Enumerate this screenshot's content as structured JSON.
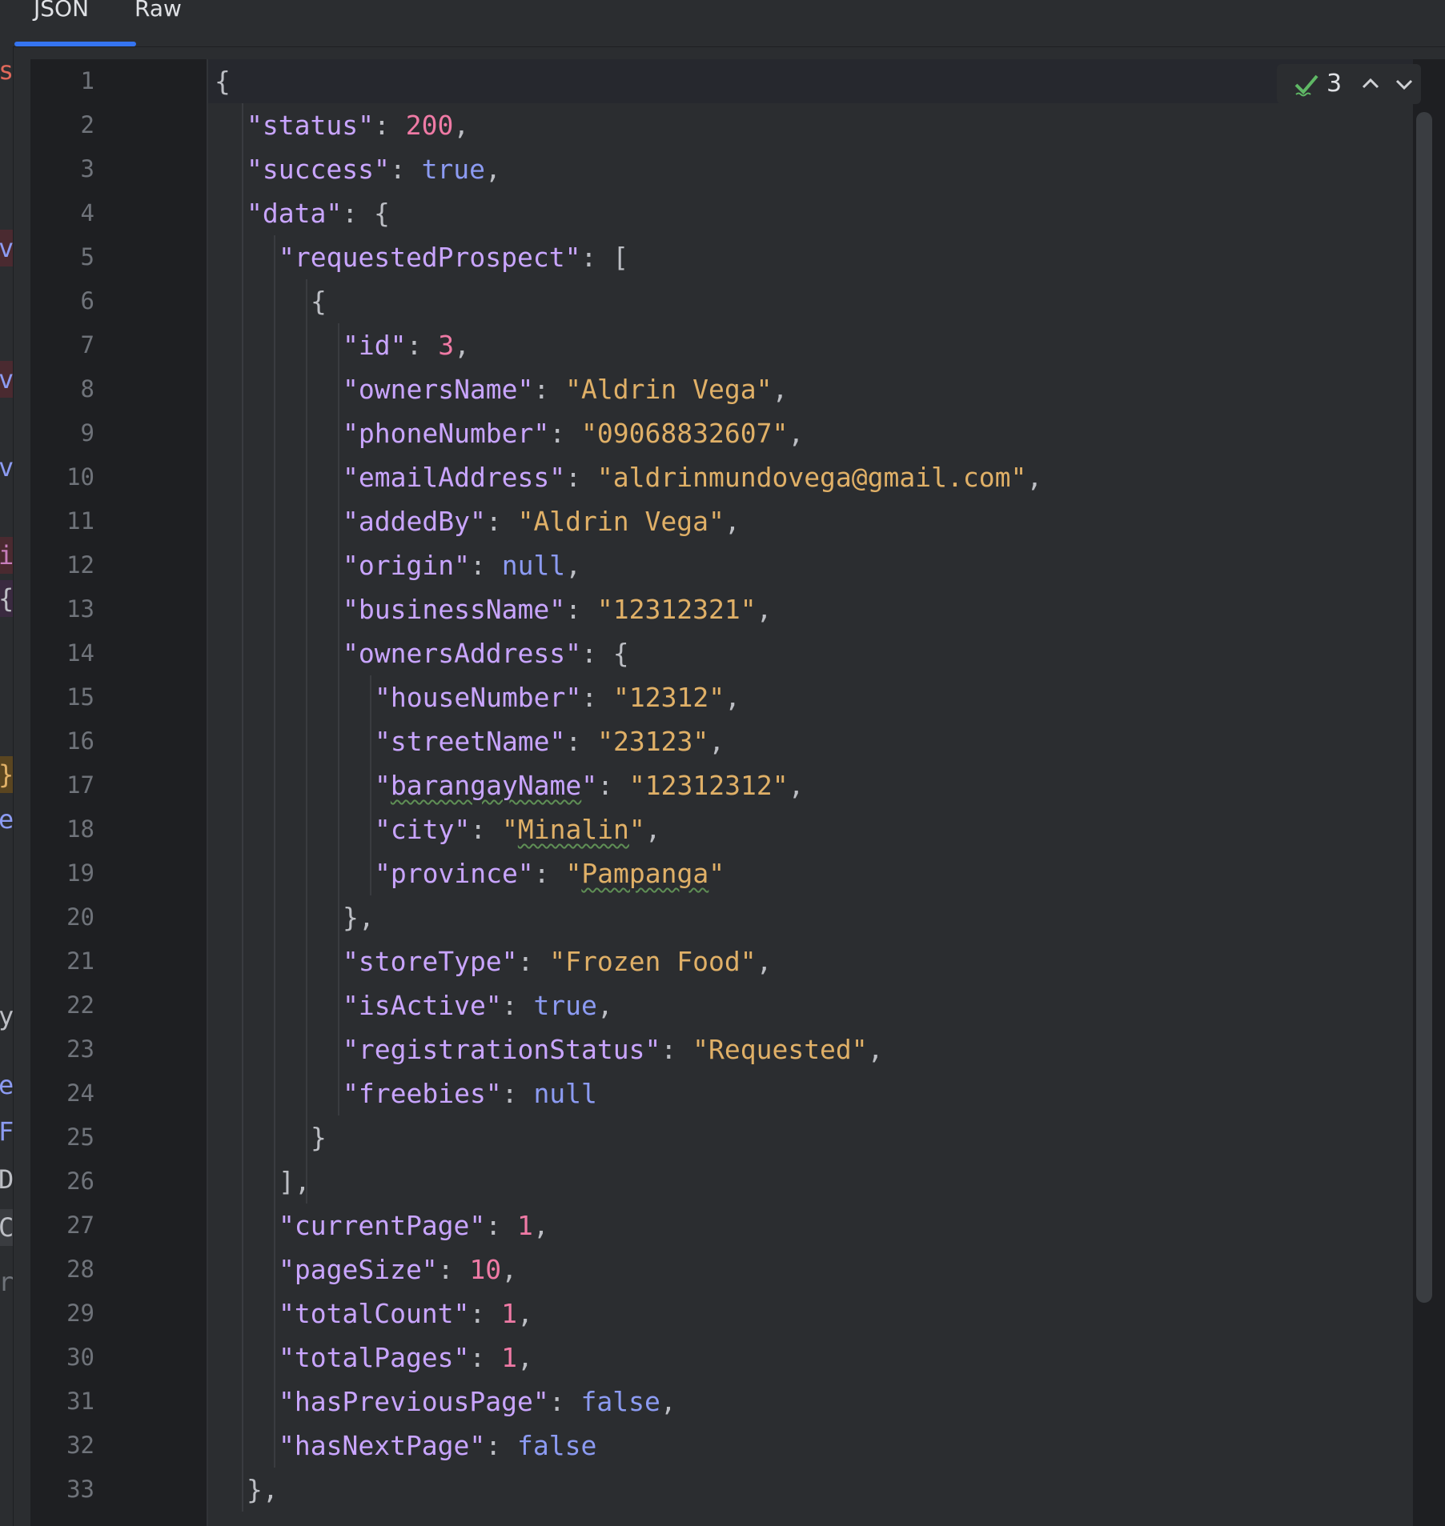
{
  "tabs": [
    {
      "label": "JSON",
      "active": true
    },
    {
      "label": "Raw",
      "active": false
    }
  ],
  "left_strip_fragments": [
    "s",
    "v",
    "v",
    "v",
    "i",
    "{",
    "}",
    "e",
    "y",
    "e",
    "F",
    "Da",
    "C",
    "re"
  ],
  "inspection": {
    "count": "3"
  },
  "line_numbers": [
    "1",
    "2",
    "3",
    "4",
    "5",
    "6",
    "7",
    "8",
    "9",
    "10",
    "11",
    "12",
    "13",
    "14",
    "15",
    "16",
    "17",
    "18",
    "19",
    "20",
    "21",
    "22",
    "23",
    "24",
    "25",
    "26",
    "27",
    "28",
    "29",
    "30",
    "31",
    "32",
    "33"
  ],
  "json": {
    "status": "200",
    "success": "true",
    "requestedProspect": {
      "id": "3",
      "ownersName": "Aldrin Vega",
      "phoneNumber": "09068832607",
      "emailAddress": "aldrinmundovega@gmail.com",
      "addedBy": "Aldrin Vega",
      "origin": "null",
      "businessName": "12312321",
      "ownersAddress": {
        "houseNumber": "12312",
        "streetName": "23123",
        "barangayName": "12312312",
        "city": "Minalin",
        "province": "Pampanga"
      },
      "storeType": "Frozen Food",
      "isActive": "true",
      "registrationStatus": "Requested",
      "freebies": "null"
    },
    "currentPage": "1",
    "pageSize": "10",
    "totalCount": "1",
    "totalPages": "1",
    "hasPreviousPage": "false",
    "hasNextPage": "false"
  },
  "colors": {
    "key": "#c9a5ff",
    "string": "#e0b067",
    "number": "#ef7aa5",
    "keyword": "#8c9bf2",
    "accent": "#3574f0"
  }
}
